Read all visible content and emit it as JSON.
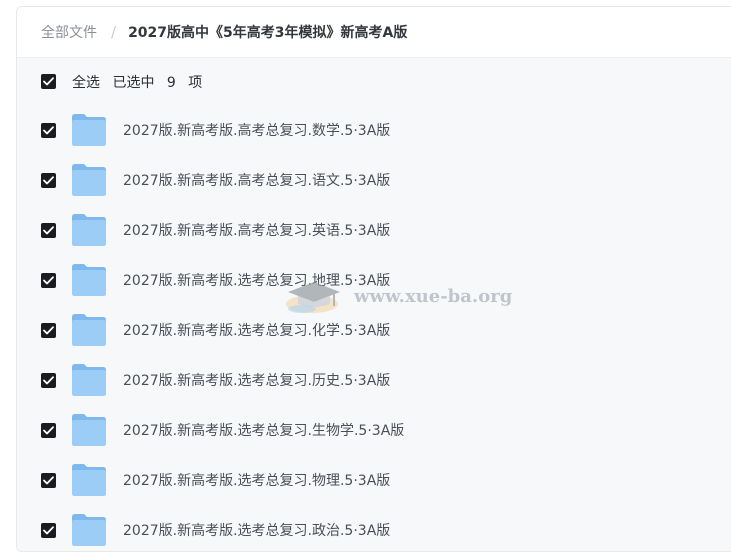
{
  "breadcrumb": {
    "root": "全部文件",
    "separator": "/",
    "current": "2027版高中《5年高考3年模拟》新高考A版"
  },
  "selection": {
    "select_all_label": "全选",
    "selected_prefix": "已选中",
    "selected_count": "9",
    "selected_suffix": "项",
    "checked": true
  },
  "files": [
    {
      "name": "2027版.新高考版.高考总复习.数学.5·3A版",
      "icon": "folder-icon",
      "checked": true
    },
    {
      "name": "2027版.新高考版.高考总复习.语文.5·3A版",
      "icon": "folder-icon",
      "checked": true
    },
    {
      "name": "2027版.新高考版.高考总复习.英语.5·3A版",
      "icon": "folder-icon",
      "checked": true
    },
    {
      "name": "2027版.新高考版.选考总复习.地理.5·3A版",
      "icon": "folder-icon",
      "checked": true
    },
    {
      "name": "2027版.新高考版.选考总复习.化学.5·3A版",
      "icon": "folder-icon",
      "checked": true
    },
    {
      "name": "2027版.新高考版.选考总复习.历史.5·3A版",
      "icon": "folder-icon",
      "checked": true
    },
    {
      "name": "2027版.新高考版.选考总复习.生物学.5·3A版",
      "icon": "folder-icon",
      "checked": true
    },
    {
      "name": "2027版.新高考版.选考总复习.物理.5·3A版",
      "icon": "folder-icon",
      "checked": true
    },
    {
      "name": "2027版.新高考版.选考总复习.政治.5·3A版",
      "icon": "folder-icon",
      "checked": true
    }
  ],
  "watermark": {
    "text": "www.xue-ba.org"
  },
  "colors": {
    "folder": "#8ec3f2",
    "checkbox": "#1a1c20",
    "list_background": "#f7f8fa"
  }
}
